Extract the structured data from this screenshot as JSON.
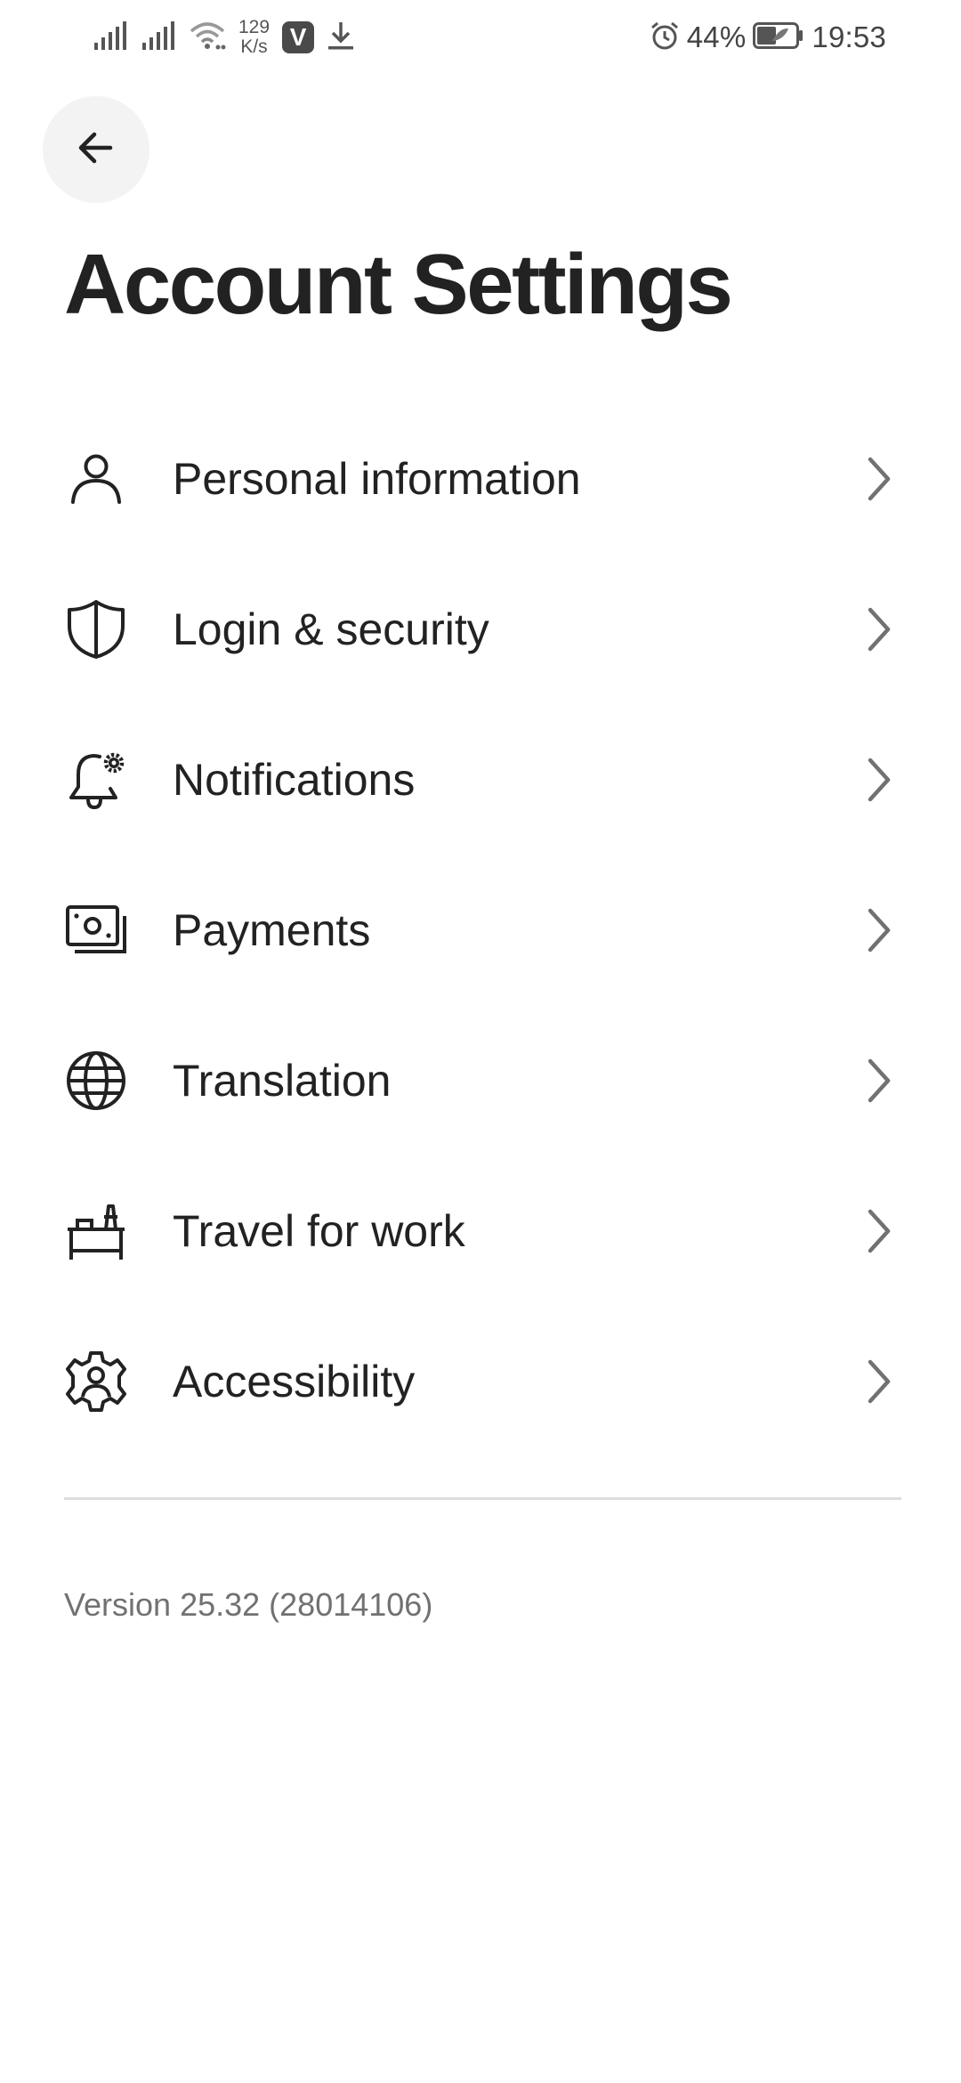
{
  "status_bar": {
    "net_speed_value": "129",
    "net_speed_unit": "K/s",
    "vpn_badge": "V",
    "battery": "44%",
    "time": "19:53",
    "icons": [
      "signal-icon",
      "signal-icon",
      "wifi-icon",
      "download-icon",
      "alarm-icon",
      "battery-icon"
    ]
  },
  "header": {
    "back_icon": "arrow-left-icon",
    "title": "Account Settings"
  },
  "menu": {
    "items": [
      {
        "label": "Personal information",
        "icon": "person-icon"
      },
      {
        "label": "Login & security",
        "icon": "shield-icon"
      },
      {
        "label": "Notifications",
        "icon": "bell-gear-icon"
      },
      {
        "label": "Payments",
        "icon": "money-icon"
      },
      {
        "label": "Translation",
        "icon": "globe-icon"
      },
      {
        "label": "Travel for work",
        "icon": "desk-icon"
      },
      {
        "label": "Accessibility",
        "icon": "accessibility-gear-icon"
      }
    ]
  },
  "footer": {
    "version": "Version 25.32 (28014106)"
  },
  "colors": {
    "text_primary": "#222222",
    "text_secondary": "#717171",
    "chevron": "#717171",
    "back_button_bg": "#f3f3f3",
    "divider": "#dddddd"
  }
}
